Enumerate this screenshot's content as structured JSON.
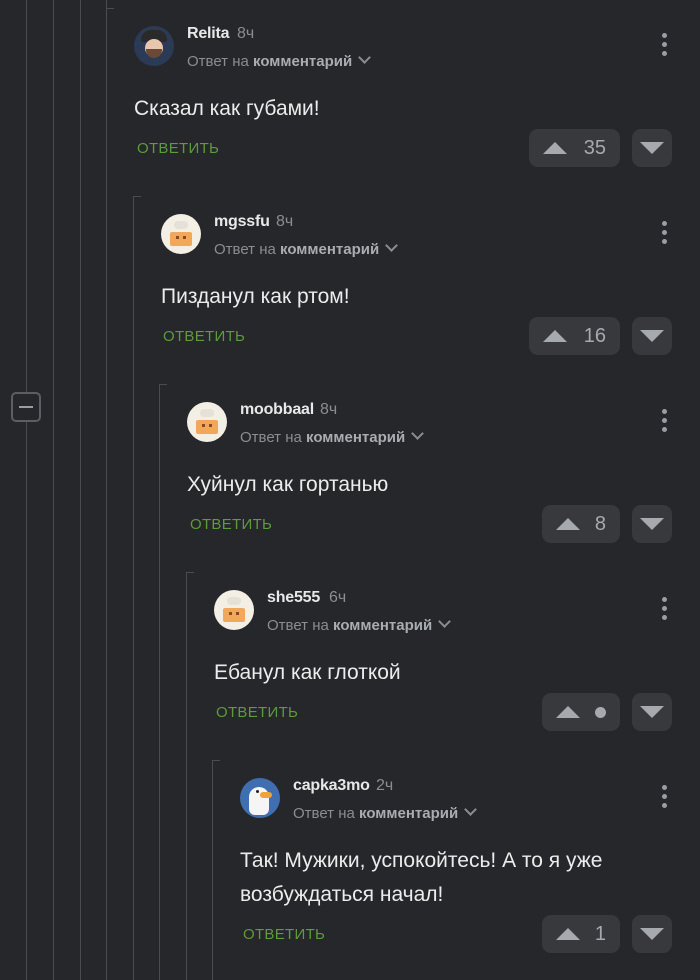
{
  "comments": [
    {
      "username": "Relita",
      "time": "8ч",
      "reply_prefix": "Ответ на",
      "reply_target": "комментарий",
      "text": "Сказал как губами!",
      "reply_label": "ОТВЕТИТЬ",
      "votes": "35",
      "avatar": "user-photo-avatar"
    },
    {
      "username": "mgssfu",
      "time": "8ч",
      "reply_prefix": "Ответ на",
      "reply_target": "комментарий",
      "text": "Пизданул как ртом!",
      "reply_label": "ОТВЕТИТЬ",
      "votes": "16",
      "avatar": "default-avatar"
    },
    {
      "username": "moobbaal",
      "time": "8ч",
      "reply_prefix": "Ответ на",
      "reply_target": "комментарий",
      "text": "Хуйнул как гортанью",
      "reply_label": "ОТВЕТИТЬ",
      "votes": "8",
      "avatar": "default-avatar"
    },
    {
      "username": "she555",
      "time": "6ч",
      "reply_prefix": "Ответ на",
      "reply_target": "комментарий",
      "text": "Ебанул как глоткой",
      "reply_label": "ОТВЕТИТЬ",
      "votes": "",
      "avatar": "default-avatar"
    },
    {
      "username": "capka3mo",
      "time": "2ч",
      "reply_prefix": "Ответ на",
      "reply_target": "комментарий",
      "text_line1": "Так! Мужики, успокойтесь! А то я уже",
      "text_line2": "возбуждаться начал!",
      "reply_label": "ОТВЕТИТЬ",
      "votes": "1",
      "avatar": "goose-avatar"
    }
  ],
  "colors": {
    "background": "#25272a",
    "reply": "#5f9a3c",
    "vote_bg": "#37393d"
  },
  "icons": [
    "collapse-thread-icon",
    "chevron-down-icon",
    "more-options-icon",
    "upvote-icon",
    "downvote-icon"
  ]
}
